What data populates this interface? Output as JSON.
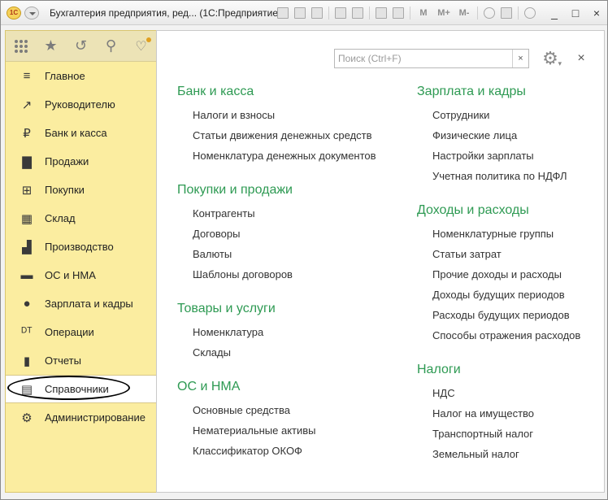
{
  "window": {
    "logo_text": "1С",
    "title": "Бухгалтерия предприятия, ред... (1С:Предприятие)",
    "toolbar_text_buttons": [
      "M",
      "M+",
      "M-"
    ],
    "controls": [
      "_",
      "□",
      "×"
    ]
  },
  "sidebar": {
    "toolbar": [
      {
        "icon": "apps-grid-icon"
      },
      {
        "icon": "star-icon",
        "glyph": "★"
      },
      {
        "icon": "history-icon",
        "glyph": "↺"
      },
      {
        "icon": "search-icon",
        "glyph": "⚲"
      },
      {
        "icon": "bell-icon",
        "glyph": "🔔"
      }
    ],
    "items": [
      {
        "label": "Главное",
        "icon": "menu-lines-icon",
        "glyph": "≡"
      },
      {
        "label": "Руководителю",
        "icon": "trend-icon",
        "glyph": "↗"
      },
      {
        "label": "Банк и касса",
        "icon": "ruble-icon",
        "glyph": "₽"
      },
      {
        "label": "Продажи",
        "icon": "bag-icon",
        "glyph": "▇"
      },
      {
        "label": "Покупки",
        "icon": "cart-icon",
        "glyph": "⊞"
      },
      {
        "label": "Склад",
        "icon": "warehouse-icon",
        "glyph": "▦"
      },
      {
        "label": "Производство",
        "icon": "factory-icon",
        "glyph": "▟"
      },
      {
        "label": "ОС и НМА",
        "icon": "truck-icon",
        "glyph": "▬"
      },
      {
        "label": "Зарплата и кадры",
        "icon": "person-icon",
        "glyph": "●"
      },
      {
        "label": "Операции",
        "icon": "dt-kt-icon",
        "glyph": "ᴰᵀ"
      },
      {
        "label": "Отчеты",
        "icon": "bar-chart-icon",
        "glyph": "▮"
      },
      {
        "label": "Справочники",
        "icon": "book-icon",
        "glyph": "▤",
        "active": true
      },
      {
        "label": "Администрирование",
        "icon": "gear-icon",
        "glyph": "⚙"
      }
    ]
  },
  "main": {
    "search": {
      "placeholder": "Поиск (Ctrl+F)",
      "value": "",
      "clear_glyph": "×"
    },
    "settings_glyph": "⚙",
    "close_glyph": "×",
    "left_sections": [
      {
        "title": "Банк и касса",
        "links": [
          "Налоги и взносы",
          "Статьи движения денежных средств",
          "Номенклатура денежных документов"
        ]
      },
      {
        "title": "Покупки и продажи",
        "links": [
          "Контрагенты",
          "Договоры",
          "Валюты",
          "Шаблоны договоров"
        ]
      },
      {
        "title": "Товары и услуги",
        "links": [
          "Номенклатура",
          "Склады"
        ]
      },
      {
        "title": "ОС и НМА",
        "links": [
          "Основные средства",
          "Нематериальные активы",
          "Классификатор ОКОФ"
        ]
      }
    ],
    "right_sections": [
      {
        "title": "Зарплата и кадры",
        "links": [
          "Сотрудники",
          "Физические лица",
          "Настройки зарплаты",
          "Учетная политика по НДФЛ"
        ]
      },
      {
        "title": "Доходы и расходы",
        "links": [
          "Номенклатурные группы",
          "Статьи затрат",
          "Прочие доходы и расходы",
          "Доходы будущих периодов",
          "Расходы будущих периодов",
          "Способы отражения расходов"
        ]
      },
      {
        "title": "Налоги",
        "links": [
          "НДС",
          "Налог на имущество",
          "Транспортный налог",
          "Земельный налог"
        ]
      }
    ]
  }
}
